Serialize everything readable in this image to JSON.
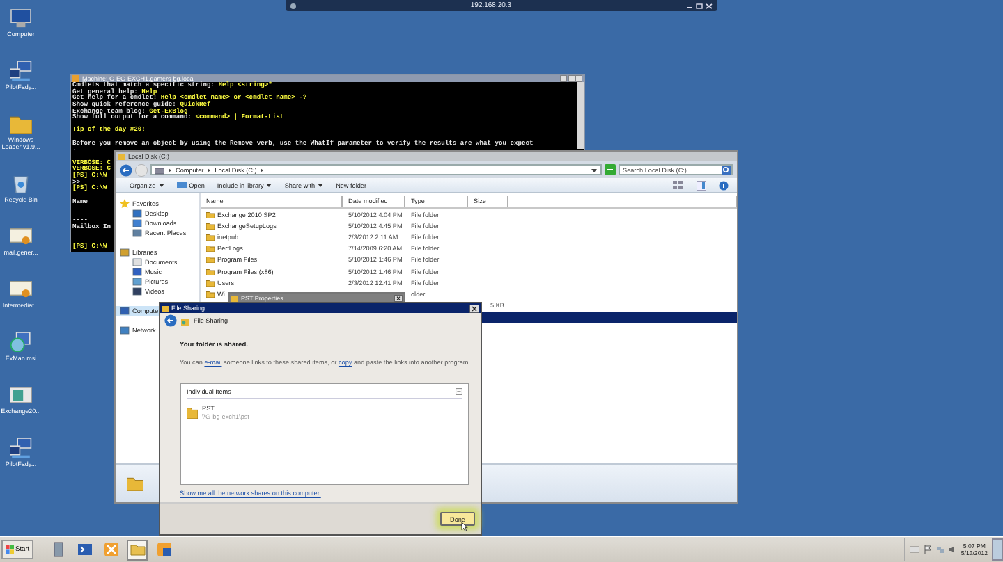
{
  "remote_bar": {
    "title": "192.168.20.3"
  },
  "desktop_icons": [
    {
      "label": "Computer",
      "kind": "computer"
    },
    {
      "label": "PilotFady...",
      "kind": "network"
    },
    {
      "label": "Windows Loader v1.9...",
      "kind": "folder"
    },
    {
      "label": "Recycle Bin",
      "kind": "recycle"
    },
    {
      "label": "mail.gener...",
      "kind": "certificate"
    },
    {
      "label": "Intermediat...",
      "kind": "certificate"
    },
    {
      "label": "ExMan.msi",
      "kind": "installer"
    },
    {
      "label": "Exchange20...",
      "kind": "app"
    },
    {
      "label": "PilotFady...",
      "kind": "network"
    }
  ],
  "console": {
    "title": "Machine: G-EG-EXCH1.gamers-bg.local",
    "lines": [
      {
        "kind": "text",
        "parts": [
          {
            "text": "Cmdlets that match a specific string: ",
            "bright": false
          },
          {
            "text": "Help <string>*",
            "bright": true
          }
        ]
      },
      {
        "kind": "text",
        "parts": [
          {
            "text": "Get general help: ",
            "bright": false
          },
          {
            "text": "Help",
            "bright": true
          }
        ]
      },
      {
        "kind": "text",
        "parts": [
          {
            "text": "Get help for a cmdlet: ",
            "bright": false
          },
          {
            "text": "Help <cmdlet name> or <cmdlet name> -?",
            "bright": true
          }
        ]
      },
      {
        "kind": "text",
        "parts": [
          {
            "text": "Show quick reference guide: ",
            "bright": false
          },
          {
            "text": "QuickRef",
            "bright": true
          }
        ]
      },
      {
        "kind": "text",
        "parts": [
          {
            "text": "Exchange team blog: ",
            "bright": false
          },
          {
            "text": "Get-ExBlog",
            "bright": true
          }
        ]
      },
      {
        "kind": "text",
        "parts": [
          {
            "text": "Show full output for a command: ",
            "bright": false
          },
          {
            "text": "<command> | Format-List",
            "bright": true
          }
        ]
      },
      {
        "kind": "blank"
      },
      {
        "kind": "text",
        "parts": [
          {
            "text": "Tip of the day #20:",
            "bright": true
          }
        ]
      },
      {
        "kind": "blank"
      },
      {
        "kind": "text",
        "parts": [
          {
            "text": "Before you remove an object by using the Remove verb, use the WhatIf parameter to verify the results are what you expect",
            "bright": false
          }
        ]
      },
      {
        "kind": "text",
        "parts": [
          {
            "text": ".",
            "bright": false
          }
        ]
      },
      {
        "kind": "blank"
      },
      {
        "kind": "text",
        "parts": [
          {
            "text": "VERBOSE: C",
            "bright": true
          }
        ]
      },
      {
        "kind": "text",
        "parts": [
          {
            "text": "VERBOSE: C",
            "bright": true
          }
        ]
      },
      {
        "kind": "text",
        "parts": [
          {
            "text": "[PS] C:\\W",
            "bright": true
          }
        ]
      },
      {
        "kind": "text",
        "parts": [
          {
            "text": ">>",
            "bright": false
          }
        ]
      },
      {
        "kind": "text",
        "parts": [
          {
            "text": "[PS] C:\\W",
            "bright": true
          }
        ]
      },
      {
        "kind": "blank"
      },
      {
        "kind": "text",
        "parts": [
          {
            "text": "Name",
            "bright": false
          }
        ]
      },
      {
        "kind": "blank"
      },
      {
        "kind": "blank"
      },
      {
        "kind": "text",
        "parts": [
          {
            "text": "----",
            "bright": false
          }
        ]
      },
      {
        "kind": "text",
        "parts": [
          {
            "text": "Mailbox In",
            "bright": false
          }
        ]
      },
      {
        "kind": "blank"
      },
      {
        "kind": "blank"
      },
      {
        "kind": "text",
        "parts": [
          {
            "text": "[PS] C:\\W",
            "bright": true
          }
        ]
      }
    ]
  },
  "explorer": {
    "title": "Local Disk (C:)",
    "breadcrumb": [
      "Computer",
      "Local Disk (C:)"
    ],
    "search": {
      "placeholder": "Search Local Disk (C:)"
    },
    "toolbar": [
      {
        "label": "Organize",
        "dropdown": true,
        "kind": "text"
      },
      {
        "label": "Open",
        "dropdown": false,
        "kind": "open"
      },
      {
        "label": "Include in library",
        "dropdown": true,
        "kind": "text"
      },
      {
        "label": "Share with",
        "dropdown": true,
        "kind": "text"
      },
      {
        "label": "New folder",
        "dropdown": false,
        "kind": "text"
      }
    ],
    "nav": [
      {
        "label": "Favorites",
        "kind": "star",
        "selected": false,
        "children": [
          {
            "label": "Desktop",
            "kind": "desktop",
            "selected": false
          },
          {
            "label": "Downloads",
            "kind": "downloads",
            "selected": false
          },
          {
            "label": "Recent Places",
            "kind": "recent",
            "selected": false
          }
        ]
      },
      {
        "label": "Libraries",
        "kind": "library",
        "selected": false,
        "children": [
          {
            "label": "Documents",
            "kind": "documents",
            "selected": false
          },
          {
            "label": "Music",
            "kind": "music",
            "selected": false
          },
          {
            "label": "Pictures",
            "kind": "pictures",
            "selected": false
          },
          {
            "label": "Videos",
            "kind": "videos",
            "selected": false
          }
        ]
      },
      {
        "label": "Compute",
        "kind": "computer",
        "selected": true
      },
      {
        "label": "Network",
        "kind": "network",
        "selected": false
      }
    ],
    "columns": [
      "Name",
      "Date modified",
      "Type",
      "Size"
    ],
    "rows": [
      {
        "name": "Exchange 2010 SP2",
        "date": "5/10/2012 4:04 PM",
        "type": "File folder",
        "selected": false
      },
      {
        "name": "ExchangeSetupLogs",
        "date": "5/10/2012 4:45 PM",
        "type": "File folder",
        "selected": false
      },
      {
        "name": "inetpub",
        "date": "2/3/2012 2:11 AM",
        "type": "File folder",
        "selected": false
      },
      {
        "name": "PerfLogs",
        "date": "7/14/2009 6:20 AM",
        "type": "File folder",
        "selected": false
      },
      {
        "name": "Program Files",
        "date": "5/10/2012 1:46 PM",
        "type": "File folder",
        "selected": false
      },
      {
        "name": "Program Files (x86)",
        "date": "5/10/2012 1:46 PM",
        "type": "File folder",
        "selected": false
      },
      {
        "name": "Users",
        "date": "2/3/2012 12:41 PM",
        "type": "File folder",
        "selected": false
      },
      {
        "name": "Wi",
        "type": "older",
        "selected": false
      },
      {
        "size": "5 KB",
        "selected": false
      },
      {
        "selected": true
      }
    ]
  },
  "pst_properties": {
    "title": "PST Properties"
  },
  "file_sharing": {
    "title": "File Sharing",
    "header": "File Sharing",
    "status": "Your folder is shared.",
    "message": [
      {
        "text": "You can ",
        "link": false
      },
      {
        "text": "e-mail",
        "link": true
      },
      {
        "text": " someone links to these shared items, or ",
        "link": false
      },
      {
        "text": "copy",
        "link": true
      },
      {
        "text": " and paste the links into another program.",
        "link": false
      }
    ],
    "list_header": "Individual Items",
    "items": [
      {
        "name": "PST",
        "path": "\\\\G-bg-exch1\\pst"
      }
    ],
    "link": "Show me all the network shares on this computer.",
    "button": "Done"
  },
  "taskbar": {
    "start": "Start",
    "apps": [
      {
        "kind": "server",
        "selected": false
      },
      {
        "kind": "powershell",
        "selected": false
      },
      {
        "kind": "exchange",
        "selected": false
      },
      {
        "kind": "explorer",
        "selected": true
      },
      {
        "kind": "exchange-shell",
        "selected": false
      }
    ],
    "time": "5:07 PM",
    "date": "5/13/2012"
  }
}
